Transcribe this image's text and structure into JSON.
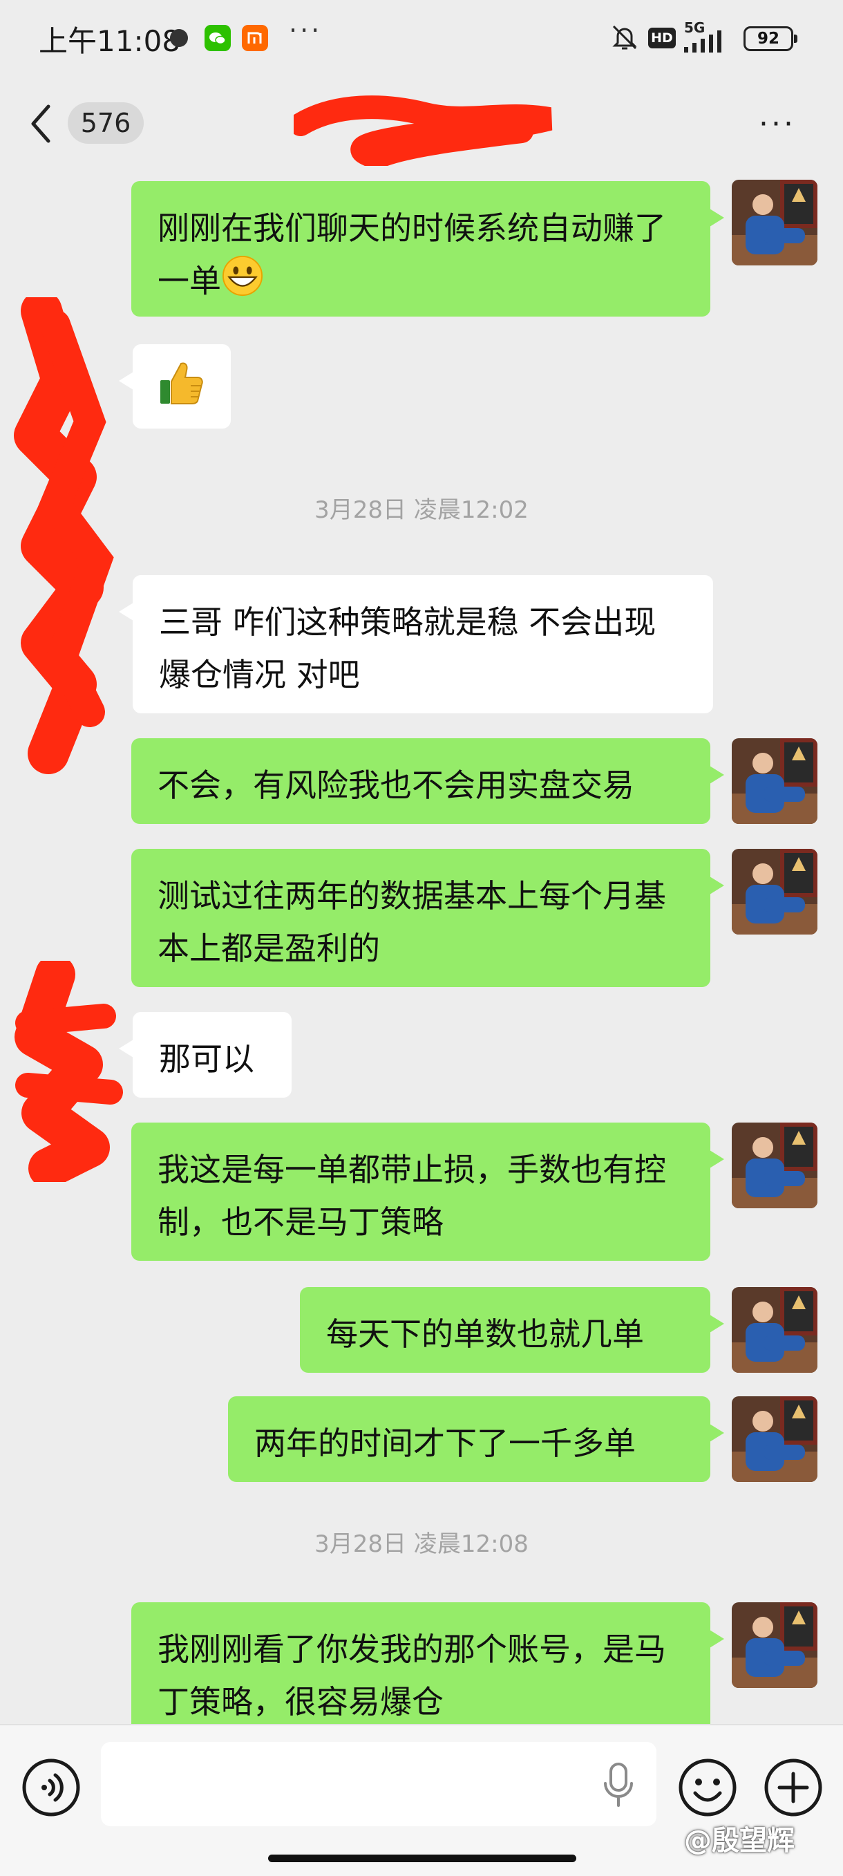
{
  "status_bar": {
    "time": "上午11:08",
    "network": "5G",
    "hd_label": "HD",
    "battery": "92",
    "colors": {
      "wechat": "#2dc100",
      "mi": "#ff6900"
    }
  },
  "nav": {
    "unread_count": "576",
    "more_label": "···",
    "back_icon": "chevron-left-icon"
  },
  "messages": [
    {
      "side": "me",
      "text": "刚刚在我们聊天的时候系统自动赚了一单",
      "trailing_emoji": "grinning-face-emoji"
    },
    {
      "side": "other",
      "icon": "thumbs-up-emoji"
    },
    {
      "type": "time",
      "text": "3月28日 凌晨12:02"
    },
    {
      "side": "other",
      "text": "三哥 咋们这种策略就是稳 不会出现爆仓情况 对吧"
    },
    {
      "side": "me",
      "text": "不会，有风险我也不会用实盘交易"
    },
    {
      "side": "me",
      "text": "测试过往两年的数据基本上每个月基本上都是盈利的"
    },
    {
      "side": "other",
      "text": "那可以"
    },
    {
      "side": "me",
      "text": "我这是每一单都带止损，手数也有控制，也不是马丁策略"
    },
    {
      "side": "me",
      "text": "每天下的单数也就几单"
    },
    {
      "side": "me",
      "text": "两年的时间才下了一千多单"
    },
    {
      "type": "time",
      "text": "3月28日 凌晨12:08"
    },
    {
      "side": "me",
      "text": "我刚刚看了你发我的那个账号，是马丁策略，很容易爆仓"
    }
  ],
  "input_bar": {
    "placeholder": "",
    "icons": [
      "voice-icon",
      "mic-icon",
      "emoji-icon",
      "plus-icon"
    ]
  },
  "watermark": "@殷望辉",
  "colors": {
    "bubble_me": "#95ec69",
    "bubble_other": "#ffffff",
    "background": "#ededed",
    "redaction": "#ff2a10"
  }
}
